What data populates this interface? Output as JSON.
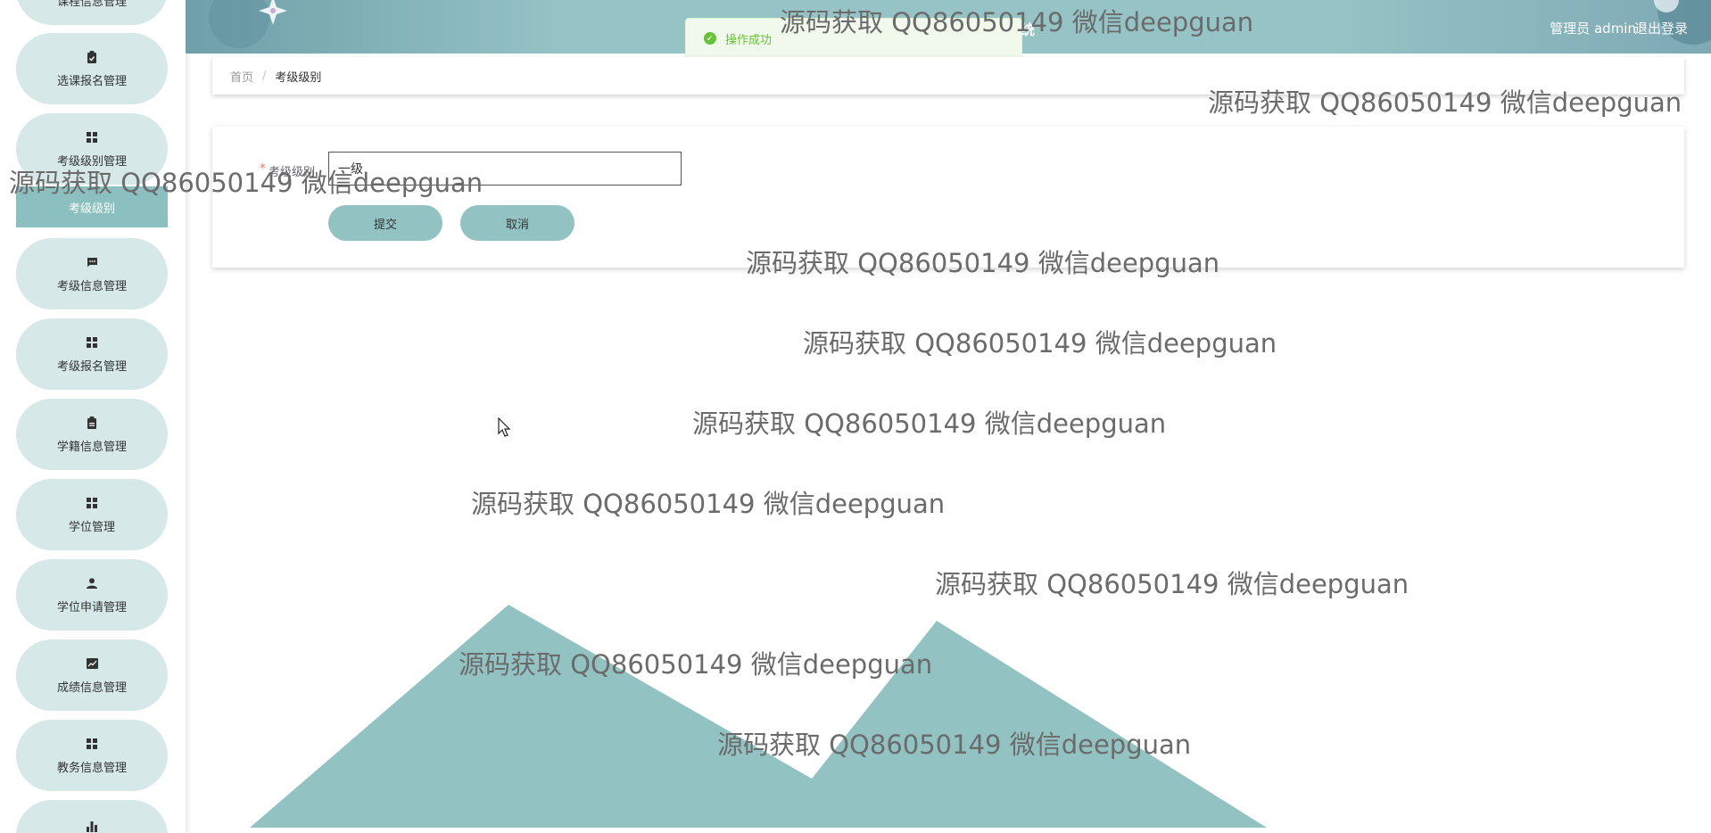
{
  "sidebar": {
    "items": [
      {
        "label": "课程信息管理",
        "icon": "clipboard-icon"
      },
      {
        "label": "选课报名管理",
        "icon": "clipboard-check-icon"
      },
      {
        "label": "考级级别管理",
        "icon": "grid-icon"
      },
      {
        "label": "考级信息管理",
        "icon": "chat-icon"
      },
      {
        "label": "考级报名管理",
        "icon": "grid-icon"
      },
      {
        "label": "学籍信息管理",
        "icon": "clipboard-icon"
      },
      {
        "label": "学位管理",
        "icon": "grid-icon"
      },
      {
        "label": "学位申请管理",
        "icon": "user-icon"
      },
      {
        "label": "成绩信息管理",
        "icon": "line-chart-icon"
      },
      {
        "label": "教务信息管理",
        "icon": "grid-icon"
      },
      {
        "label": "",
        "icon": "bar-chart-icon"
      }
    ],
    "active_sub": "考级级别"
  },
  "header": {
    "title_partial": "统",
    "user": "管理员 admin",
    "logout": "退出登录"
  },
  "toast": {
    "message": "操作成功"
  },
  "breadcrumb": {
    "home": "首页",
    "separator": "/",
    "current": "考级级别"
  },
  "form": {
    "required_mark": "*",
    "level_label": "考级级别",
    "level_value": "一级",
    "submit": "提交",
    "cancel": "取消"
  },
  "watermark": "源码获取 QQ86050149 微信deepguan",
  "colors": {
    "accent": "#93c2c3",
    "pill": "#d6e8e8",
    "sub_active": "#8cbfbf",
    "header": "#96c3c5",
    "success": "#67c23a"
  }
}
